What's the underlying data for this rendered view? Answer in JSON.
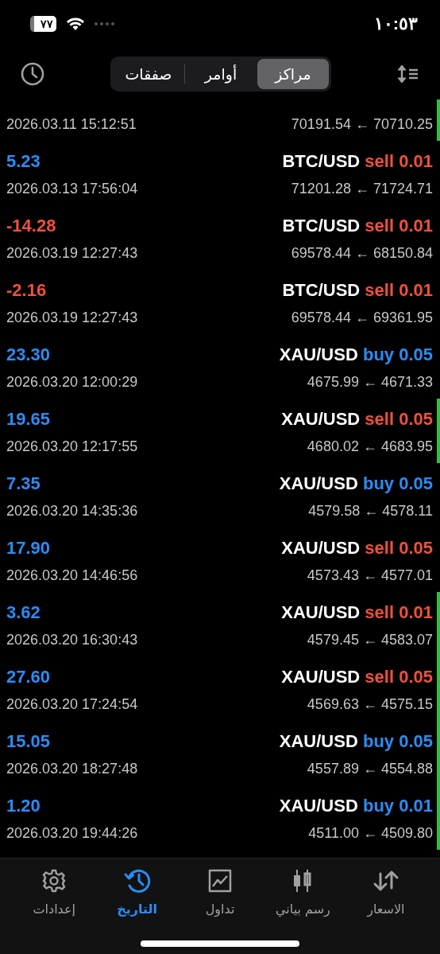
{
  "status_bar": {
    "time": "١٠:٥٣",
    "battery": "٧٧"
  },
  "segments": [
    {
      "label": "مراكز",
      "selected": true
    },
    {
      "label": "أوامر",
      "selected": false
    },
    {
      "label": "صفقات",
      "selected": false
    }
  ],
  "rows": [
    {
      "kind": "partial",
      "time": "2026.03.11 15:12:51",
      "prices": "70191.54 ← 70710.25",
      "marked": true
    },
    {
      "kind": "full",
      "profit": "5.23",
      "color": "#2a8cf5",
      "symbol": "BTC/USD",
      "side": "sell",
      "volume": "0.01",
      "time": "2026.03.13 17:56:04",
      "prices": "71201.28 ← 71724.71",
      "marked": false
    },
    {
      "kind": "full",
      "profit": "-14.28",
      "color": "#f0503c",
      "symbol": "BTC/USD",
      "side": "sell",
      "volume": "0.01",
      "time": "2026.03.19 12:27:43",
      "prices": "69578.44 ← 68150.84",
      "marked": false
    },
    {
      "kind": "full",
      "profit": "-2.16",
      "color": "#f0503c",
      "symbol": "BTC/USD",
      "side": "sell",
      "volume": "0.01",
      "time": "2026.03.19 12:27:43",
      "prices": "69578.44 ← 69361.95",
      "marked": false
    },
    {
      "kind": "full",
      "profit": "23.30",
      "color": "#2a8cf5",
      "symbol": "XAU/USD",
      "side": "buy",
      "volume": "0.05",
      "time": "2026.03.20 12:00:29",
      "prices": "4675.99 ← 4671.33",
      "marked": false
    },
    {
      "kind": "full",
      "profit": "19.65",
      "color": "#2a8cf5",
      "symbol": "XAU/USD",
      "side": "sell",
      "volume": "0.05",
      "time": "2026.03.20 12:17:55",
      "prices": "4680.02 ← 4683.95",
      "marked": true
    },
    {
      "kind": "full",
      "profit": "7.35",
      "color": "#2a8cf5",
      "symbol": "XAU/USD",
      "side": "buy",
      "volume": "0.05",
      "time": "2026.03.20 14:35:36",
      "prices": "4579.58 ← 4578.11",
      "marked": false
    },
    {
      "kind": "full",
      "profit": "17.90",
      "color": "#2a8cf5",
      "symbol": "XAU/USD",
      "side": "sell",
      "volume": "0.05",
      "time": "2026.03.20 14:46:56",
      "prices": "4573.43 ← 4577.01",
      "marked": false
    },
    {
      "kind": "full",
      "profit": "3.62",
      "color": "#2a8cf5",
      "symbol": "XAU/USD",
      "side": "sell",
      "volume": "0.01",
      "time": "2026.03.20 16:30:43",
      "prices": "4579.45 ← 4583.07",
      "marked": true
    },
    {
      "kind": "full",
      "profit": "27.60",
      "color": "#2a8cf5",
      "symbol": "XAU/USD",
      "side": "sell",
      "volume": "0.05",
      "time": "2026.03.20 17:24:54",
      "prices": "4569.63 ← 4575.15",
      "marked": true
    },
    {
      "kind": "full",
      "profit": "15.05",
      "color": "#2a8cf5",
      "symbol": "XAU/USD",
      "side": "buy",
      "volume": "0.05",
      "time": "2026.03.20 18:27:48",
      "prices": "4557.89 ← 4554.88",
      "marked": true
    },
    {
      "kind": "full",
      "profit": "1.20",
      "color": "#2a8cf5",
      "symbol": "XAU/USD",
      "side": "buy",
      "volume": "0.01",
      "time": "2026.03.20 19:44:26",
      "prices": "4511.00 ← 4509.80",
      "marked": true
    }
  ],
  "tab_bar": [
    {
      "kind": "quotes",
      "label": "الاسعار",
      "selected": false
    },
    {
      "kind": "chart",
      "label": "رسم بياني",
      "selected": false
    },
    {
      "kind": "trade",
      "label": "تداول",
      "selected": false
    },
    {
      "kind": "history",
      "label": "التاريخ",
      "selected": true
    },
    {
      "kind": "settings",
      "label": "إعدادات",
      "selected": false
    }
  ]
}
